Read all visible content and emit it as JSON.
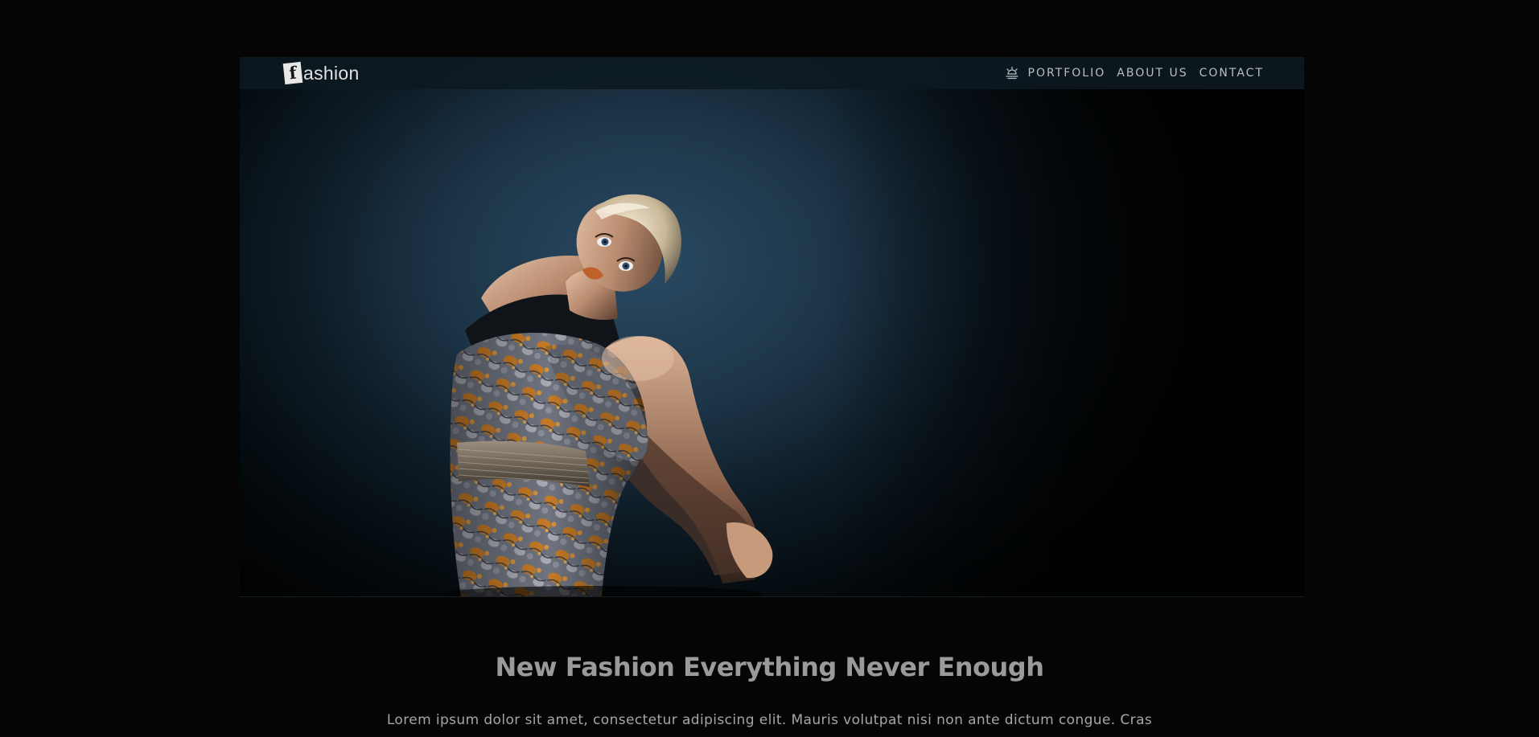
{
  "header": {
    "logo_mark": "f",
    "logo_text": "ashion",
    "nav": {
      "icon": "lamp-icon",
      "items": [
        "PORTFOLIO",
        "ABOUT US",
        "CONTACT"
      ]
    }
  },
  "hero": {
    "image": "fashion-model-photo"
  },
  "content": {
    "headline": "New Fashion Everything Never Enough",
    "paragraph": "Lorem ipsum dolor sit amet, consectetur adipiscing elit. Mauris volutpat nisi non ante dictum congue. Cras"
  },
  "colors": {
    "background": "#040404",
    "navbar": "#0c1921",
    "hero_blue": "#2a4a63",
    "headline": "#9a9a9a"
  }
}
